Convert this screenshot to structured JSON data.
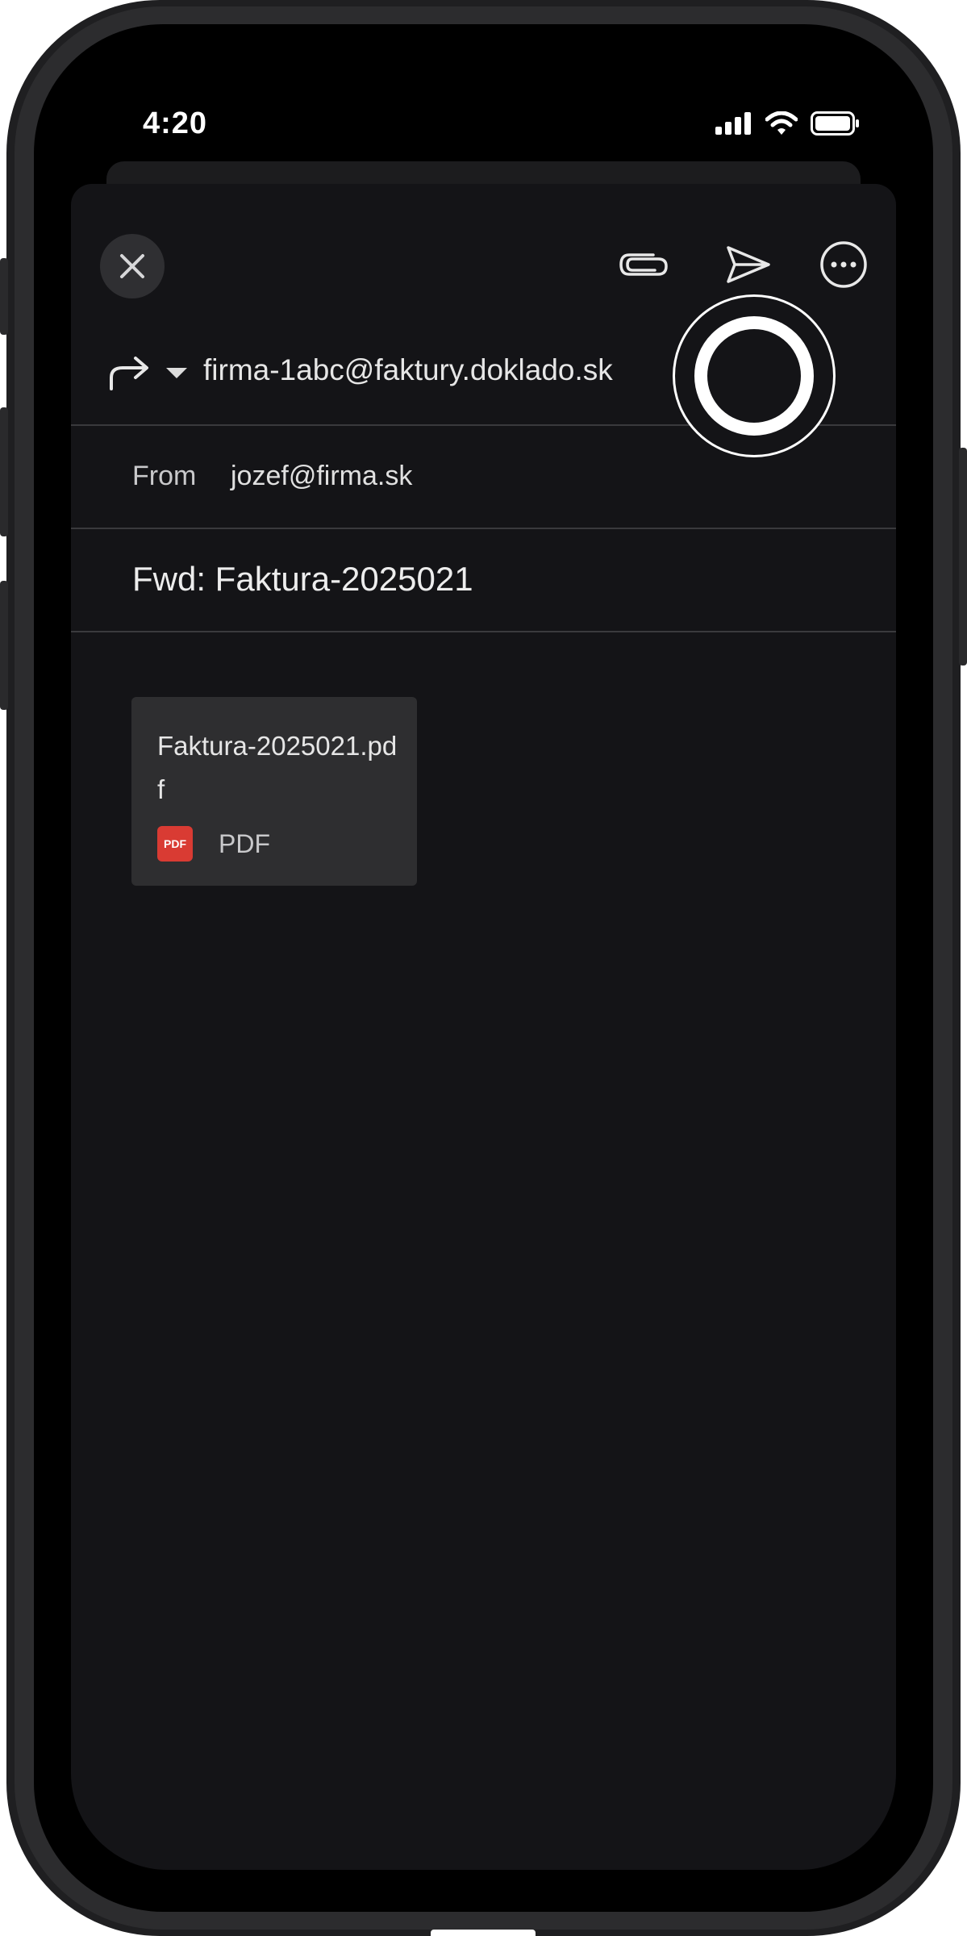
{
  "status_bar": {
    "time": "4:20",
    "icons": [
      "signal-icon",
      "wifi-icon",
      "battery-icon"
    ]
  },
  "toolbar": {
    "close_icon": "close-icon",
    "attach_icon": "paperclip-icon",
    "send_icon": "send-icon",
    "more_icon": "more-icon"
  },
  "compose": {
    "to_value": "firma-1abc@faktury.doklado.sk",
    "from_label": "From",
    "from_value": "jozef@firma.sk",
    "subject": "Fwd: Faktura-2025021"
  },
  "attachment": {
    "name": "Faktura-2025021.pdf",
    "badge": "PDF",
    "type": "PDF"
  },
  "colors": {
    "background": "#141417",
    "divider": "#3a3a3d",
    "pdf_red": "#d93b33"
  }
}
